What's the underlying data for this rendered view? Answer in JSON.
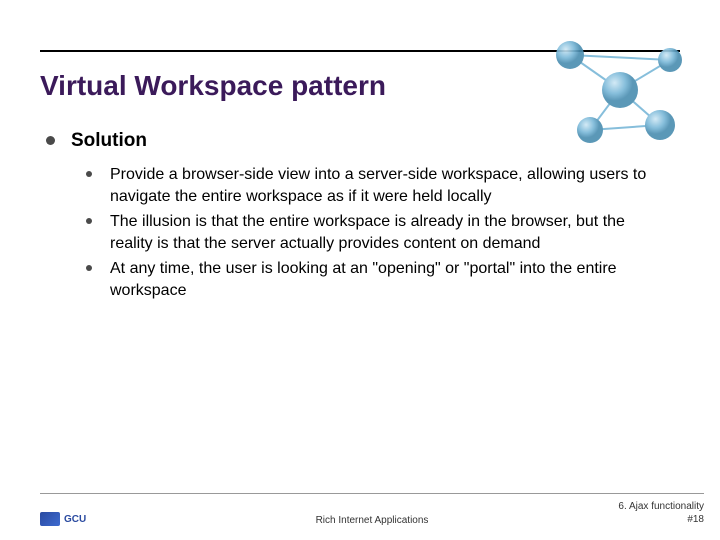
{
  "title": "Virtual Workspace pattern",
  "heading": "Solution",
  "bullets": [
    "Provide a browser-side view into a server-side workspace, allowing users to navigate the entire workspace as if it were held locally",
    "The illusion is that the entire workspace is already in the browser, but the reality is that the server actually provides content on demand",
    "At any time, the user is looking at an \"opening\" or \"portal\" into the entire workspace"
  ],
  "footer": {
    "logo": "GCU",
    "center": "Rich Internet Applications",
    "right_top": "6. Ajax functionality",
    "right_bottom": "#18"
  }
}
